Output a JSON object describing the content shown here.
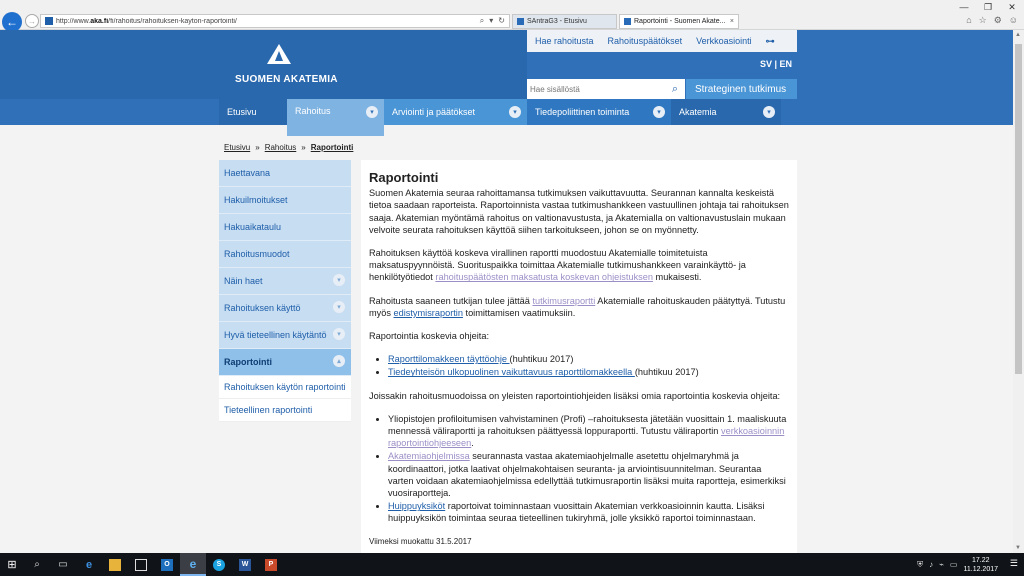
{
  "browser": {
    "url_prefix": "http://www.",
    "url_domain": "aka.fi",
    "url_path": "/fi/rahoitus/rahoituksen-kayton-raportointi/",
    "tabs": [
      {
        "title": "SAntraG3 - Etusivu"
      },
      {
        "title": "Raportointi - Suomen Akate..."
      }
    ],
    "tab_close": "×",
    "window_controls": {
      "minimize": "—",
      "restore": "❐",
      "close": "✕"
    }
  },
  "header": {
    "logo_text": "SUOMEN AKATEMIA",
    "top_links": [
      "Hae rahoitusta",
      "Rahoituspäätökset",
      "Verkkoasiointi"
    ],
    "lang": "SV | EN",
    "search_placeholder": "Hae sisällöstä",
    "strategic_button": "Strateginen tutkimus",
    "nav": [
      "Etusivu",
      "Rahoitus",
      "Arviointi ja päätökset",
      "Tiedepoliittinen toiminta",
      "Akatemia"
    ]
  },
  "breadcrumb": {
    "items": [
      "Etusivu",
      "Rahoitus",
      "Raportointi"
    ],
    "separator": "»"
  },
  "sidebar": {
    "items": [
      {
        "label": "Haettavana"
      },
      {
        "label": "Hakuilmoitukset"
      },
      {
        "label": "Hakuaikataulu"
      },
      {
        "label": "Rahoitusmuodot"
      },
      {
        "label": "Näin haet"
      },
      {
        "label": "Rahoituksen käyttö"
      },
      {
        "label": "Hyvä tieteellinen käytäntö"
      },
      {
        "label": "Raportointi"
      }
    ],
    "subitems": [
      {
        "label": "Rahoituksen käytön raportointi"
      },
      {
        "label": "Tieteellinen raportointi"
      }
    ]
  },
  "content": {
    "title": "Raportointi",
    "p1": "Suomen Akatemia seuraa rahoittamansa tutkimuksen vaikuttavuutta. Seurannan kannalta keskeistä tietoa saadaan raporteista. Raportoinnista vastaa tutkimushankkeen vastuullinen johtaja tai rahoituksen saaja. Akatemian myöntämä rahoitus on valtionavustusta, ja Akatemialla on valtionavustuslain mukaan velvoite seurata rahoituksen käyttöä siihen tarkoitukseen, johon se on myönnetty.",
    "p2_a": "Rahoituksen käyttöä koskeva virallinen raportti muodostuu Akatemialle toimitetuista maksatuspyynnöistä. Suorituspaikka toimittaa Akatemialle tutkimushankkeen varainkäyttö- ja henkilötyötiedot ",
    "p2_link": "rahoituspäätösten maksatusta koskevan ohjeistuksen",
    "p2_b": " mukaisesti.",
    "p3_a": "Rahoitusta saaneen tutkijan tulee jättää ",
    "p3_link1": "tutkimusraportti",
    "p3_b": " Akatemialle rahoituskauden päätyttyä. Tutustu myös ",
    "p3_link2": "edistymisraportin",
    "p3_c": " toimittamisen vaatimuksiin.",
    "p4": "Raportointia koskevia ohjeita:",
    "list1": [
      {
        "link": "Raporttilomakkeen täyttöohje ",
        "text": "(huhtikuu 2017)"
      },
      {
        "link": "Tiedeyhteisön ulkopuolinen vaikuttavuus raporttilomakkeella ",
        "text": "(huhtikuu 2017)"
      }
    ],
    "p5": "Joissakin rahoitusmuodoissa on yleisten raportointiohjeiden lisäksi omia raportointia koskevia ohjeita:",
    "l2_1_a": "Yliopistojen profiloitumisen vahvistaminen (Profi) –rahoituksesta jätetään vuosittain 1. maaliskuuta mennessä väliraportti ja rahoituksen päättyessä loppuraportti. Tutustu väliraportin ",
    "l2_1_link": "verkkoasioinnin raportointiohjeeseen",
    "l2_1_b": ".",
    "l2_2_link": "Akatemiaohjelmissa",
    "l2_2_text": " seurannasta vastaa akatemiaohjelmalle asetettu ohjelmaryhmä ja koordinaattori, jotka laativat ohjelmakohtaisen seuranta- ja arviointisuunnitelman. Seurantaa varten voidaan akatemiaohjelmissa edellyttää tutkimusraportin lisäksi muita raportteja, esimerkiksi vuosiraportteja.",
    "l2_3_link": "Huippuyksiköt",
    "l2_3_text": " raportoivat toiminnastaan vuosittain Akatemian verkkoasioinnin kautta. Lisäksi huippuyksikön toimintaa seuraa tieteellinen tukiryhmä, jolle yksikkö raportoi toiminnastaan.",
    "modified": "Viimeksi muokattu 31.5.2017"
  },
  "taskbar": {
    "time": "17.22",
    "date": "11.12.2017",
    "app_letters": {
      "outlook": "O",
      "word": "W",
      "powerpoint": "P",
      "skype": "S"
    }
  },
  "icons": {
    "back": "←",
    "forward": "→",
    "search": "⌕",
    "chevron_down": "▾",
    "chevron_up": "▴",
    "key": "⊶",
    "home": "⌂",
    "star": "☆",
    "gear": "⚙",
    "smiley": "☺",
    "start": "⊞",
    "taskview": "▭",
    "scroll_up": "▲",
    "scroll_down": "▼"
  }
}
